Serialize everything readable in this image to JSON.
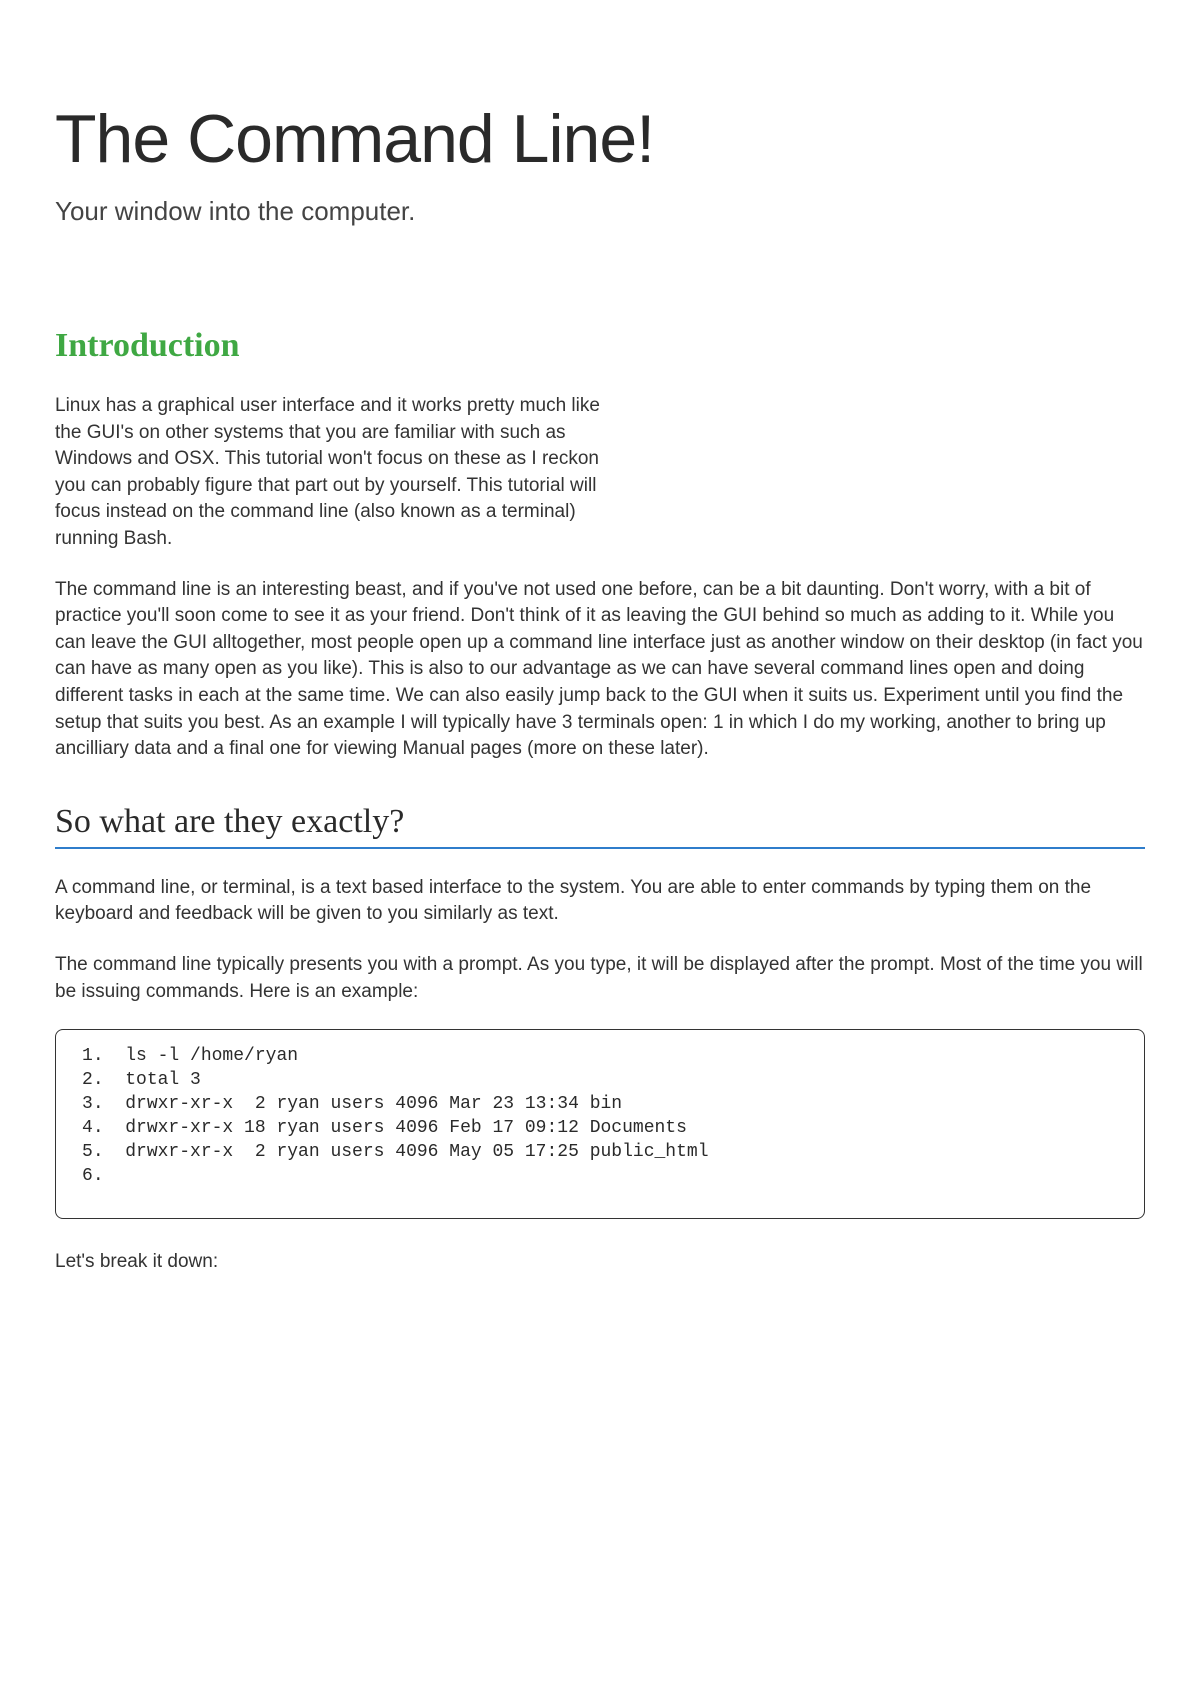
{
  "title": "The Command Line!",
  "subtitle": "Your window into the computer.",
  "sections": {
    "intro": {
      "heading": "Introduction",
      "para1": "Linux has a graphical user interface and it works pretty much like the GUI's on other systems that you are familiar with such as Windows and OSX. This tutorial won't focus on these as I reckon you can probably figure that part out by yourself. This tutorial will focus instead on the command line (also known as a terminal) running Bash.",
      "para2a": "The command line is an interesting beast, and if you've not used one before, can be a bit daunting. Don't worry, with a bit of practice you'll soon come to see it as your friend. Don't think of it as leaving the GUI behind so much as adding to it. While you can leave the GUI alltogether, most people open up a command line interface just as another window on their desktop (in fact you can have as many open as you like). This is also to our advantage as we can have several command lines open and doing different tasks in each at the same time. We can also easily jump back to the GUI when it suits us. Experiment until you find the setup that suits you best. As an example I will typically have 3 terminals open: 1 in which I do my working, another to bring up ancilliary data and a final one for viewing Manual pages (more on these later)."
    },
    "what": {
      "heading": "So what are they exactly?",
      "para1": "A command line, or terminal, is a text based interface to the system. You are able to enter commands by typing them on the keyboard and feedback will be given to you similarly as text.",
      "para2": "The command line typically presents you with a prompt. As you type, it will be displayed after the prompt. Most of the time you will be issuing commands. Here is an example:",
      "terminal": [
        "ls -l /home/ryan",
        "total 3",
        "drwxr-xr-x  2 ryan users 4096 Mar 23 13:34 bin",
        "drwxr-xr-x 18 ryan users 4096 Feb 17 09:12 Documents",
        "drwxr-xr-x  2 ryan users 4096 May 05 17:25 public_html",
        ""
      ],
      "para3": "Let's break it down:"
    }
  }
}
